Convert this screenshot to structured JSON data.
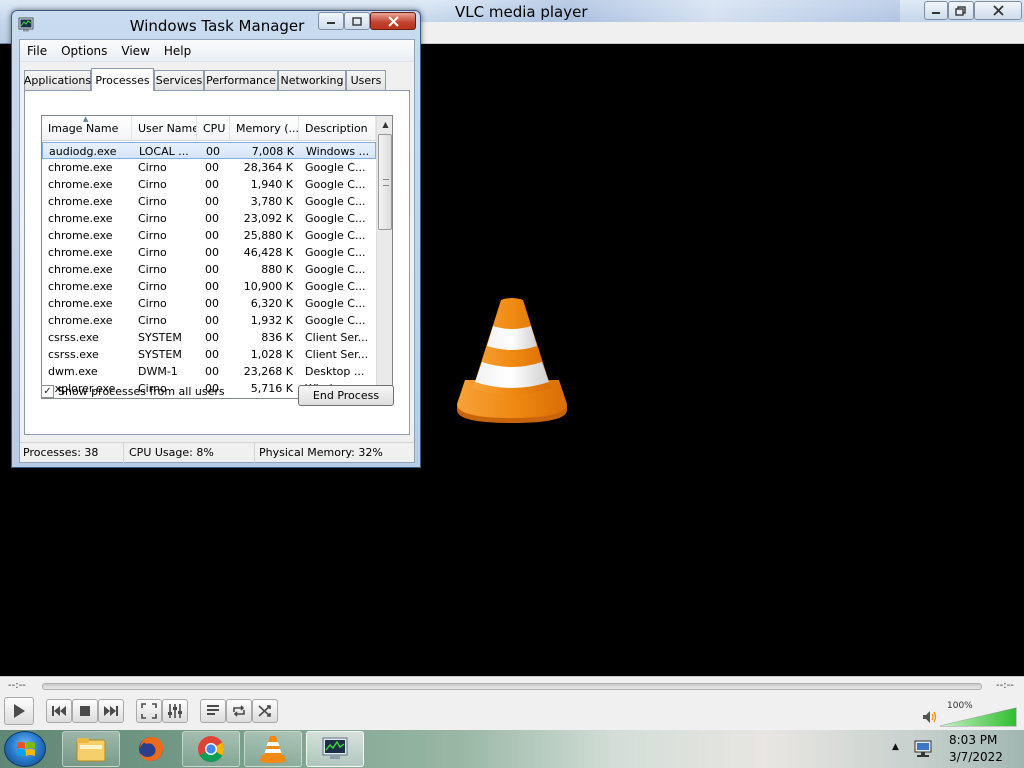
{
  "vlc": {
    "title": "VLC media player",
    "time_elapsed": "--:--",
    "time_total": "--:--",
    "seek_progress": 0,
    "volume_label": "100%",
    "volume_level": 1.0
  },
  "task_manager": {
    "title": "Windows Task Manager",
    "menu": [
      "File",
      "Options",
      "View",
      "Help"
    ],
    "tabs": [
      "Applications",
      "Processes",
      "Services",
      "Performance",
      "Networking",
      "Users"
    ],
    "active_tab": "Processes",
    "columns": [
      "Image Name",
      "User Name",
      "CPU",
      "Memory (...",
      "Description"
    ],
    "processes": [
      {
        "image": "audiodg.exe",
        "user": "LOCAL ...",
        "cpu": "00",
        "memory": "7,008 K",
        "description": "Windows ..."
      },
      {
        "image": "chrome.exe",
        "user": "Cirno",
        "cpu": "00",
        "memory": "28,364 K",
        "description": "Google C..."
      },
      {
        "image": "chrome.exe",
        "user": "Cirno",
        "cpu": "00",
        "memory": "1,940 K",
        "description": "Google C..."
      },
      {
        "image": "chrome.exe",
        "user": "Cirno",
        "cpu": "00",
        "memory": "3,780 K",
        "description": "Google C..."
      },
      {
        "image": "chrome.exe",
        "user": "Cirno",
        "cpu": "00",
        "memory": "23,092 K",
        "description": "Google C..."
      },
      {
        "image": "chrome.exe",
        "user": "Cirno",
        "cpu": "00",
        "memory": "25,880 K",
        "description": "Google C..."
      },
      {
        "image": "chrome.exe",
        "user": "Cirno",
        "cpu": "00",
        "memory": "46,428 K",
        "description": "Google C..."
      },
      {
        "image": "chrome.exe",
        "user": "Cirno",
        "cpu": "00",
        "memory": "880 K",
        "description": "Google C..."
      },
      {
        "image": "chrome.exe",
        "user": "Cirno",
        "cpu": "00",
        "memory": "10,900 K",
        "description": "Google C..."
      },
      {
        "image": "chrome.exe",
        "user": "Cirno",
        "cpu": "00",
        "memory": "6,320 K",
        "description": "Google C..."
      },
      {
        "image": "chrome.exe",
        "user": "Cirno",
        "cpu": "00",
        "memory": "1,932 K",
        "description": "Google C..."
      },
      {
        "image": "csrss.exe",
        "user": "SYSTEM",
        "cpu": "00",
        "memory": "836 K",
        "description": "Client Ser..."
      },
      {
        "image": "csrss.exe",
        "user": "SYSTEM",
        "cpu": "00",
        "memory": "1,028 K",
        "description": "Client Ser..."
      },
      {
        "image": "dwm.exe",
        "user": "DWM-1",
        "cpu": "00",
        "memory": "23,268 K",
        "description": "Desktop ..."
      },
      {
        "image": "explorer.exe",
        "user": "Cirno",
        "cpu": "00",
        "memory": "5,716 K",
        "description": "Windows ..."
      }
    ],
    "selected_row": 0,
    "show_all_label": "Show processes from all users",
    "show_all_checked": true,
    "end_process_label": "End Process",
    "status": {
      "processes": "Processes: 38",
      "cpu_usage": "CPU Usage: 8%",
      "physical_memory": "Physical Memory: 32%"
    }
  },
  "taskbar": {
    "buttons": [
      "start-orb",
      "windows-explorer-icon",
      "firefox-icon",
      "chrome-icon",
      "vlc-icon",
      "task-manager-icon"
    ],
    "clock_time": "8:03 PM",
    "clock_date": "3/7/2022"
  },
  "colors": {
    "vlc_orange": "#f08a12",
    "selection": "#d5e5f8",
    "aero_title": "#b9cde5",
    "volume_green": "#3cc63c"
  }
}
